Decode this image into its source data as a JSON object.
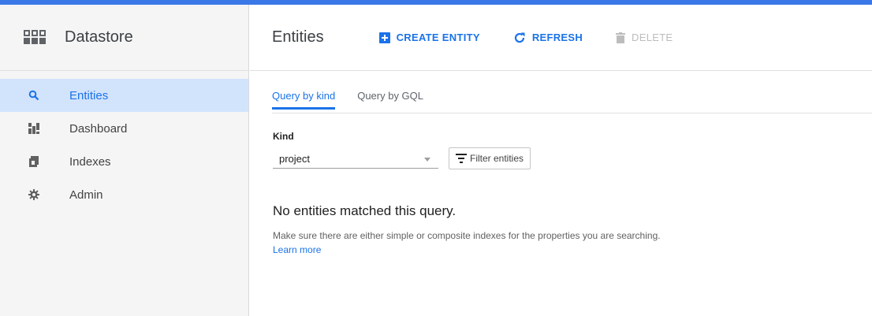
{
  "app": {
    "title": "Datastore"
  },
  "sidebar": {
    "items": [
      {
        "label": "Entities",
        "icon": "search-icon",
        "active": true
      },
      {
        "label": "Dashboard",
        "icon": "dashboard-icon",
        "active": false
      },
      {
        "label": "Indexes",
        "icon": "indexes-icon",
        "active": false
      },
      {
        "label": "Admin",
        "icon": "gear-icon",
        "active": false
      }
    ]
  },
  "header": {
    "title": "Entities",
    "create_label": "CREATE ENTITY",
    "refresh_label": "REFRESH",
    "delete_label": "DELETE"
  },
  "tabs": [
    {
      "label": "Query by kind",
      "active": true
    },
    {
      "label": "Query by GQL",
      "active": false
    }
  ],
  "query": {
    "kind_label": "Kind",
    "kind_value": "project",
    "filter_label": "Filter entities"
  },
  "empty": {
    "title": "No entities matched this query.",
    "desc_line": "Make sure there are either simple or composite indexes for the properties you are searching.",
    "learn_more": "Learn more"
  },
  "colors": {
    "accent": "#1a73e8",
    "topbar": "#3b78e7",
    "sidebar_active": "#d2e3fc",
    "disabled": "#bdbdbd"
  }
}
